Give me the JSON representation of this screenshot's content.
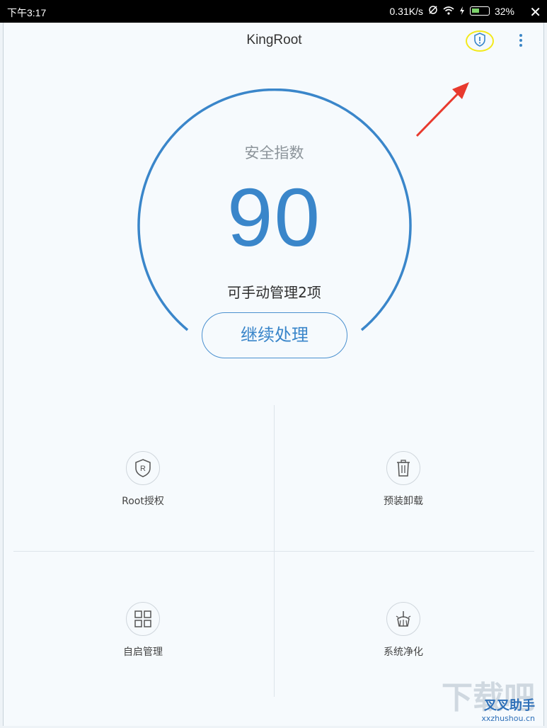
{
  "status_bar": {
    "time": "下午3:17",
    "speed": "0.31K/s",
    "battery": "32%",
    "close": "✕"
  },
  "app": {
    "title": "KingRoot",
    "shield_icon": "shield-alert-icon",
    "menu_icon": "more-vertical-icon"
  },
  "security": {
    "label": "安全指数",
    "score": "90",
    "manage_text": "可手动管理2项",
    "continue_button": "继续处理",
    "accent_color": "#3a86ca"
  },
  "tiles": [
    {
      "label": "Root授权",
      "icon": "shield-r-icon"
    },
    {
      "label": "预装卸载",
      "icon": "trash-icon"
    },
    {
      "label": "自启管理",
      "icon": "grid-icon"
    },
    {
      "label": "系统净化",
      "icon": "broom-icon"
    }
  ],
  "watermark": {
    "big": "下载吧",
    "brand": "叉叉助手",
    "url": "xxzhushou.cn"
  }
}
